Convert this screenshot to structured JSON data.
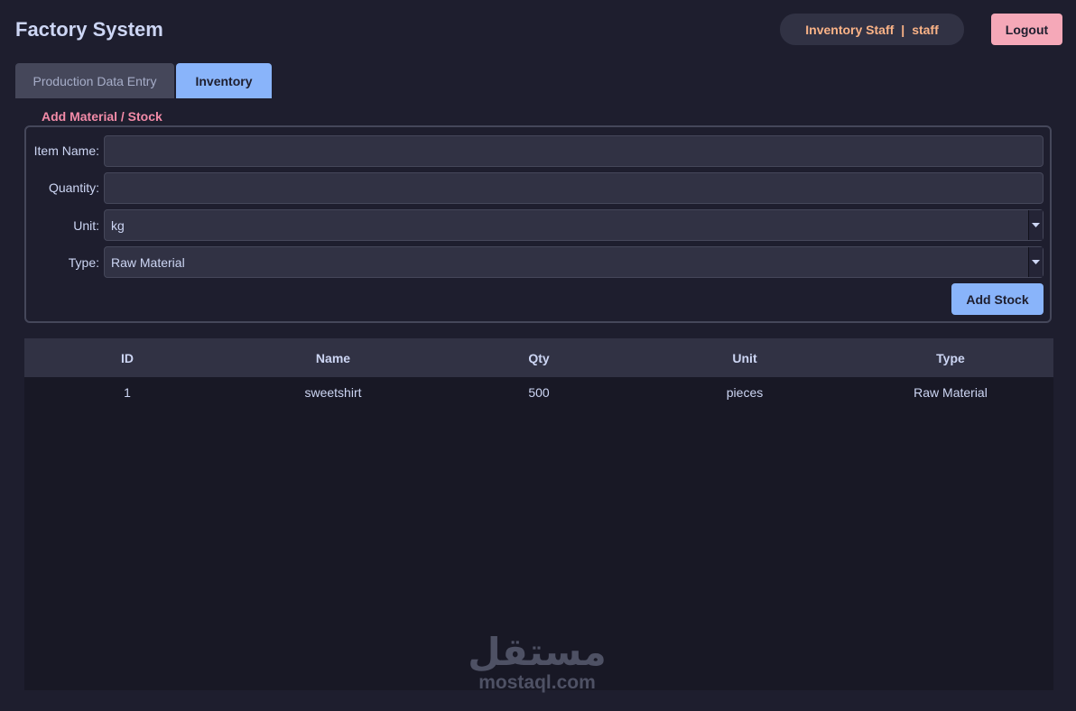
{
  "app": {
    "title": "Factory System"
  },
  "header": {
    "user_role": "Inventory Staff",
    "separator": "|",
    "username": "staff",
    "logout_label": "Logout"
  },
  "tabs": [
    {
      "label": "Production Data Entry",
      "active": false
    },
    {
      "label": "Inventory",
      "active": true
    }
  ],
  "form": {
    "group_title": "Add Material / Stock",
    "item_name": {
      "label": "Item Name:",
      "value": ""
    },
    "quantity": {
      "label": "Quantity:",
      "value": ""
    },
    "unit": {
      "label": "Unit:",
      "selected": "kg"
    },
    "type": {
      "label": "Type:",
      "selected": "Raw Material"
    },
    "submit_label": "Add Stock"
  },
  "table": {
    "columns": [
      "ID",
      "Name",
      "Qty",
      "Unit",
      "Type"
    ],
    "rows": [
      [
        "1",
        "sweetshirt",
        "500",
        "pieces",
        "Raw Material"
      ]
    ]
  },
  "watermark": {
    "arabic": "مستقل",
    "latin": "mostaql.com"
  },
  "colors": {
    "background": "#1e1e2e",
    "accent_blue": "#89b4fa",
    "accent_pink": "#f5a8b8",
    "accent_orange": "#fab387",
    "accent_red": "#f38ba8"
  }
}
